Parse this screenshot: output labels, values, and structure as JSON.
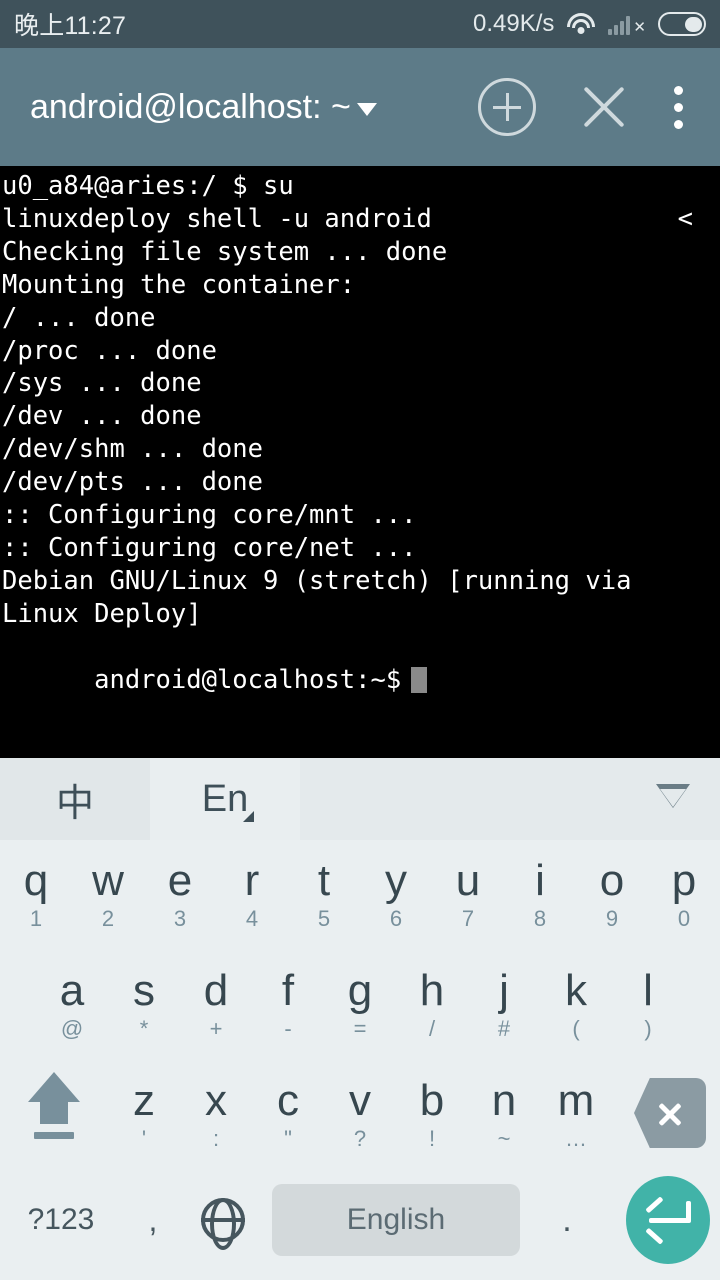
{
  "status_bar": {
    "clock": "晚上11:27",
    "network_speed": "0.49K/s",
    "wifi_icon": "wifi-icon",
    "signal_icon": "signal-bars-no-service-icon",
    "battery_icon": "battery-icon",
    "background": "#3f525b"
  },
  "app_bar": {
    "title": "android@localhost: ~",
    "dropdown_icon": "caret-down-icon",
    "new_tab_icon": "circle-plus-icon",
    "close_icon": "close-x-icon",
    "overflow_icon": "three-dot-menu-icon",
    "background": "#5d7b88"
  },
  "terminal": {
    "background": "#000000",
    "foreground": "#ffffff",
    "lines": [
      {
        "text": "u0_a84@aries:/ $ su",
        "right": ""
      },
      {
        "text": "linuxdeploy shell -u android",
        "right": "<"
      },
      {
        "text": "Checking file system ... done",
        "right": ""
      },
      {
        "text": "Mounting the container:",
        "right": ""
      },
      {
        "text": "/ ... done",
        "right": ""
      },
      {
        "text": "/proc ... done",
        "right": ""
      },
      {
        "text": "/sys ... done",
        "right": ""
      },
      {
        "text": "/dev ... done",
        "right": ""
      },
      {
        "text": "/dev/shm ... done",
        "right": ""
      },
      {
        "text": "/dev/pts ... done",
        "right": ""
      },
      {
        "text": ":: Configuring core/mnt ...",
        "right": ""
      },
      {
        "text": ":: Configuring core/net ...",
        "right": ""
      },
      {
        "text": "Debian GNU/Linux 9 (stretch) [running via",
        "right": ""
      },
      {
        "text": "Linux Deploy]",
        "right": ""
      }
    ],
    "prompt": "android@localhost:~$",
    "cursor": "block-cursor"
  },
  "keyboard": {
    "background": "#eaeff1",
    "toolbar": {
      "chinese_tab": "中",
      "english_tab": "En",
      "collapse_icon": "collapse-keyboard-icon"
    },
    "rows": [
      {
        "keys": [
          {
            "main": "q",
            "sub": "1"
          },
          {
            "main": "w",
            "sub": "2"
          },
          {
            "main": "e",
            "sub": "3"
          },
          {
            "main": "r",
            "sub": "4"
          },
          {
            "main": "t",
            "sub": "5"
          },
          {
            "main": "y",
            "sub": "6"
          },
          {
            "main": "u",
            "sub": "7"
          },
          {
            "main": "i",
            "sub": "8"
          },
          {
            "main": "o",
            "sub": "9"
          },
          {
            "main": "p",
            "sub": "0"
          }
        ]
      },
      {
        "keys": [
          {
            "main": "a",
            "sub": "@"
          },
          {
            "main": "s",
            "sub": "*"
          },
          {
            "main": "d",
            "sub": "+"
          },
          {
            "main": "f",
            "sub": "-"
          },
          {
            "main": "g",
            "sub": "="
          },
          {
            "main": "h",
            "sub": "/"
          },
          {
            "main": "j",
            "sub": "#"
          },
          {
            "main": "k",
            "sub": "("
          },
          {
            "main": "l",
            "sub": ")"
          }
        ]
      },
      {
        "keys": [
          {
            "main": "z",
            "sub": "'"
          },
          {
            "main": "x",
            "sub": ":"
          },
          {
            "main": "c",
            "sub": "\""
          },
          {
            "main": "v",
            "sub": "?"
          },
          {
            "main": "b",
            "sub": "!"
          },
          {
            "main": "n",
            "sub": "~"
          },
          {
            "main": "m",
            "sub": "…"
          }
        ],
        "shift_icon": "shift-arrow-icon",
        "backspace_icon": "backspace-icon"
      }
    ],
    "bottom_row": {
      "symbols_label": "?123",
      "comma_label": ",",
      "globe_icon": "globe-language-icon",
      "space_label": "English",
      "period_label": ".",
      "enter_icon": "enter-return-icon",
      "enter_color": "#41b3a8"
    }
  }
}
